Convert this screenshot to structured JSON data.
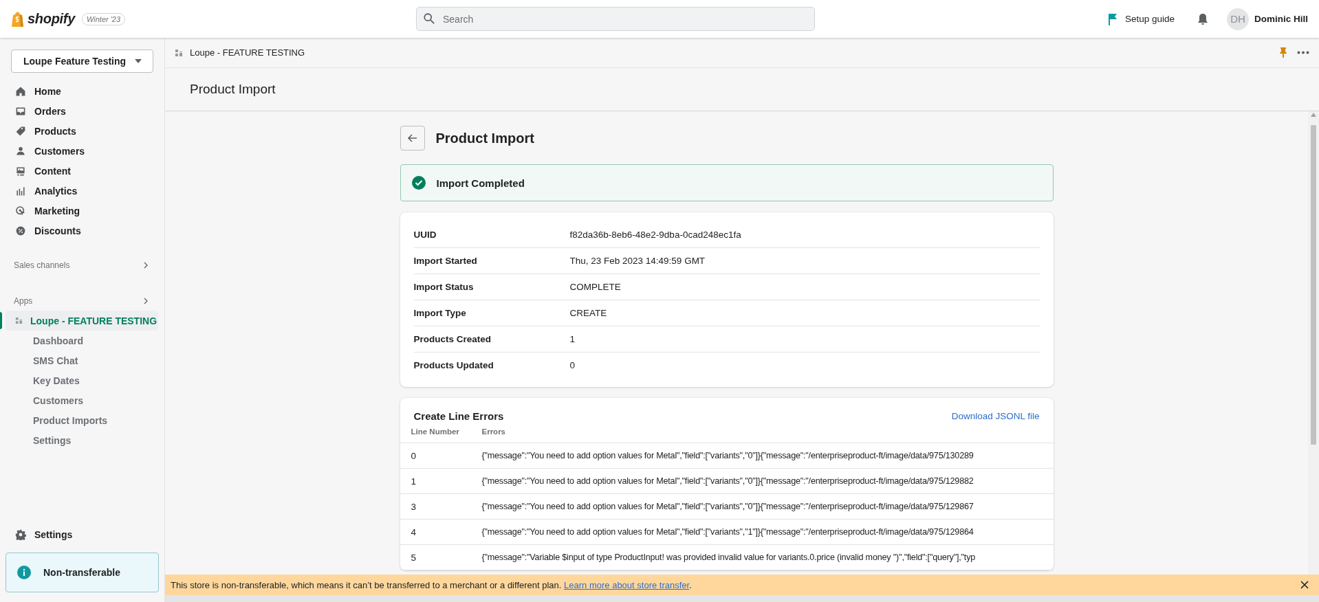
{
  "top_bar": {
    "brand": "shopify",
    "edition": "Winter '23",
    "search": {
      "placeholder": "Search"
    },
    "setup_guide": "Setup guide",
    "user": {
      "initials": "DH",
      "name": "Dominic Hill"
    }
  },
  "sidebar": {
    "store": "Loupe Feature Testing",
    "items": [
      {
        "label": "Home"
      },
      {
        "label": "Orders"
      },
      {
        "label": "Products"
      },
      {
        "label": "Customers"
      },
      {
        "label": "Content"
      },
      {
        "label": "Analytics"
      },
      {
        "label": "Marketing"
      },
      {
        "label": "Discounts"
      }
    ],
    "sales_channels": "Sales channels",
    "apps": {
      "label": "Apps",
      "app": {
        "label": "Loupe - FEATURE TESTING",
        "selected": true,
        "children": [
          {
            "label": "Dashboard",
            "selected": false
          },
          {
            "label": "SMS Chat",
            "selected": false
          },
          {
            "label": "Key Dates",
            "selected": false
          },
          {
            "label": "Customers",
            "selected": false
          },
          {
            "label": "Product Imports",
            "selected": false
          },
          {
            "label": "Settings",
            "selected": false
          }
        ]
      }
    },
    "settings": "Settings",
    "notice": "Non-transferable"
  },
  "app_header": {
    "title": "Loupe - FEATURE TESTING"
  },
  "page_title": "Product Import",
  "page": {
    "heading": "Product Import",
    "banner": {
      "kind": "success",
      "text": "Import Completed"
    },
    "details": [
      {
        "label": "UUID",
        "value": "f82da36b-8eb6-48e2-9dba-0cad248ec1fa"
      },
      {
        "label": "Import Started",
        "value": "Thu, 23 Feb 2023 14:49:59 GMT"
      },
      {
        "label": "Import Status",
        "value": "COMPLETE"
      },
      {
        "label": "Import Type",
        "value": "CREATE"
      },
      {
        "label": "Products Created",
        "value": "1"
      },
      {
        "label": "Products Updated",
        "value": "0"
      }
    ],
    "errors": {
      "title": "Create Line Errors",
      "download_link": "Download JSONL file",
      "columns": [
        "Line Number",
        "Errors"
      ],
      "rows": [
        {
          "line": "0",
          "errors": "{\"message\":\"You need to add option values for Metal\",\"field\":[\"variants\",\"0\"]}{\"message\":\"/enterpriseproduct-ft/image/data/975/130289"
        },
        {
          "line": "1",
          "errors": "{\"message\":\"You need to add option values for Metal\",\"field\":[\"variants\",\"0\"]}{\"message\":\"/enterpriseproduct-ft/image/data/975/129882"
        },
        {
          "line": "3",
          "errors": "{\"message\":\"You need to add option values for Metal\",\"field\":[\"variants\",\"0\"]}{\"message\":\"/enterpriseproduct-ft/image/data/975/129867"
        },
        {
          "line": "4",
          "errors": "{\"message\":\"You need to add option values for Metal\",\"field\":[\"variants\",\"1\"]}{\"message\":\"/enterpriseproduct-ft/image/data/975/129864"
        },
        {
          "line": "5",
          "errors": "{\"message\":\"Variable $input of type ProductInput! was provided invalid value for variants.0.price (invalid money '')\",\"field\":[\"query\"],\"typ"
        }
      ]
    }
  },
  "footer_banner": {
    "text": "This store is non-transferable, which means it can’t be transferred to a merchant or a different plan.",
    "link": "Learn more about store transfer",
    "end": "."
  }
}
